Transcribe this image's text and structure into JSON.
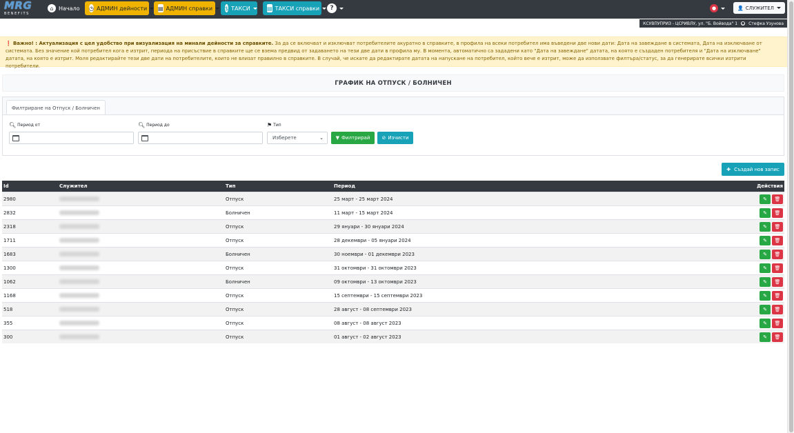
{
  "logo": {
    "main": "MRG",
    "sub": "BENEFITS"
  },
  "nav": {
    "home": "Начало",
    "admin_activities": "АДМИН дейности",
    "admin_reports": "АДМИН справки",
    "fees": "ТАКСИ",
    "fee_reports": "ТАКСИ справки",
    "help": "?",
    "employee": "СЛУЖИТЕЛ"
  },
  "location": {
    "company": "КСУВПУПРИЗ - ЦСРИВЛУ, ул. \"Б. Войвода\" 1",
    "user": "Стефка Узунова"
  },
  "warning": {
    "title": "Важно! : Актуализация с цел удобство при визуализация на минали дейности за справките.",
    "text": " За да се включват и изключват потребителите акуратно в справките, в профила на всеки потребител има въведени две нови дати: Дата на завеждане в системата, Дата на изключване от системата. Без значение кой потребител кога е изтрит, периода на присъствие в справките ще се взема предвид от задаването на тези две дати в профила му. В момента, автоматично са зададени като \"Дата на завеждане\" датата, на която е създаден потребителя и \"Дата на изключване\" датата, на която е изтрит. Моля редактирайте тези две дати на потребителите, които не влизат правилно в справките. В случай, че искате да редактирате датата на напускане на потребител, който вече е изтрит, може да използвате филтъра/статус, за да генерирате всички изтрити потребители."
  },
  "page_title": "ГРАФИК НА ОТПУСК / БОЛНИЧЕН",
  "filter": {
    "tab": "Филтриране на Отпуск / Болничен",
    "from_label": "Период от",
    "to_label": "Период до",
    "type_label": "Тип",
    "type_value": "Изберете",
    "filter_button": "Филтрирай",
    "clear_button": "Изчисти"
  },
  "create_button": "Създай нов запис",
  "table": {
    "headers": {
      "id": "Id",
      "employee": "Служител",
      "type": "Тип",
      "period": "Период",
      "actions": "Действия"
    },
    "rows": [
      {
        "id": "2980",
        "type": "Отпуск",
        "period": "25 март - 25 март 2024"
      },
      {
        "id": "2832",
        "type": "Болничен",
        "period": "11 март - 15 март 2024"
      },
      {
        "id": "2318",
        "type": "Отпуск",
        "period": "29 януари - 30 януари 2024"
      },
      {
        "id": "1711",
        "type": "Отпуск",
        "period": "28 декември - 05 януари 2024"
      },
      {
        "id": "1683",
        "type": "Болничен",
        "period": "30 ноември - 01 декември 2023"
      },
      {
        "id": "1300",
        "type": "Отпуск",
        "period": "31 октомври - 31 октомври 2023"
      },
      {
        "id": "1062",
        "type": "Болничен",
        "period": "09 октомври - 13 октомври 2023"
      },
      {
        "id": "1168",
        "type": "Отпуск",
        "period": "15 септември - 15 септември 2023"
      },
      {
        "id": "518",
        "type": "Отпуск",
        "period": "28 август - 08 септември 2023"
      },
      {
        "id": "355",
        "type": "Отпуск",
        "period": "08 август - 08 август 2023"
      },
      {
        "id": "300",
        "type": "Отпуск",
        "period": "01 август - 02 август 2023"
      }
    ]
  },
  "colors": {
    "navbar": "#343a40",
    "admin": "#f0b400",
    "fees": "#17a2b8",
    "success": "#28a745",
    "danger": "#dc3545",
    "warning_bg": "#fff3cd"
  }
}
